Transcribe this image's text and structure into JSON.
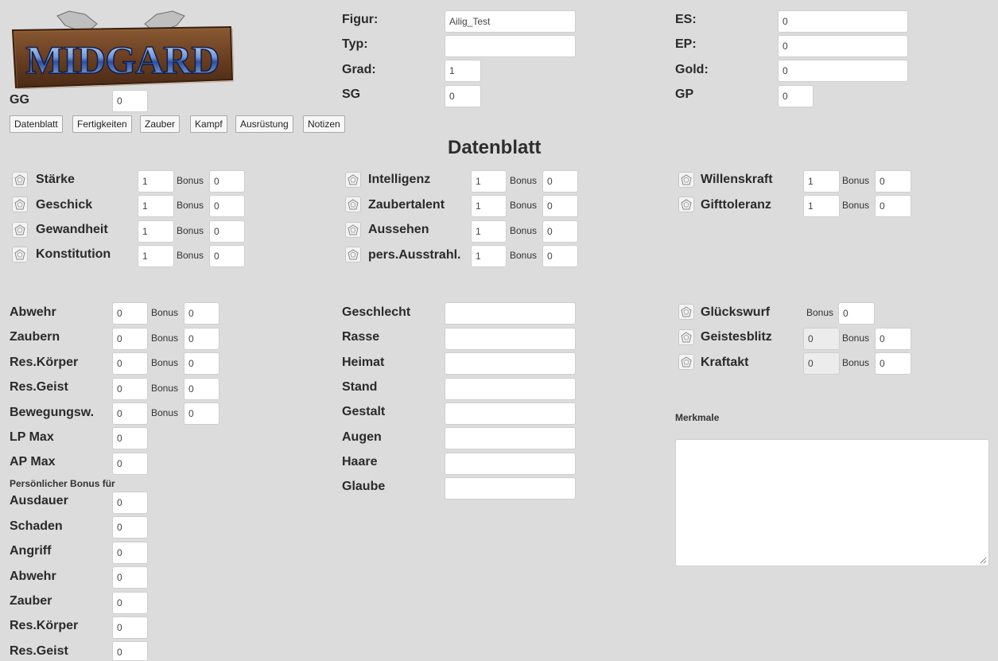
{
  "logo": {
    "text": "MIDGARD",
    "colors": {
      "wood": "#6b3f22",
      "text": "#3a5fb8",
      "highlight": "#b9d3ff"
    }
  },
  "header": {
    "gg": {
      "label": "GG",
      "value": "0"
    },
    "left_fields": [
      {
        "label": "Figur:",
        "value": "Ailig_Test"
      },
      {
        "label": "Typ:",
        "value": ""
      },
      {
        "label": "Grad:",
        "value": "1"
      },
      {
        "label": "SG",
        "value": "0"
      }
    ],
    "right_fields": [
      {
        "label": "ES:",
        "value": "0"
      },
      {
        "label": "EP:",
        "value": "0"
      },
      {
        "label": "Gold:",
        "value": "0"
      },
      {
        "label": "GP",
        "value": "0"
      }
    ]
  },
  "tabs": [
    "Datenblatt",
    "Fertigkeiten",
    "Zauber",
    "Kampf",
    "Ausrüstung",
    "Notizen"
  ],
  "page_title": "Datenblatt",
  "bonus_label": "Bonus",
  "attributes": {
    "col1": [
      {
        "label": "Stärke",
        "value": "1",
        "bonus": "0"
      },
      {
        "label": "Geschick",
        "value": "1",
        "bonus": "0"
      },
      {
        "label": "Gewandheit",
        "value": "1",
        "bonus": "0"
      },
      {
        "label": "Konstitution",
        "value": "1",
        "bonus": "0"
      }
    ],
    "col2": [
      {
        "label": "Intelligenz",
        "value": "1",
        "bonus": "0"
      },
      {
        "label": "Zaubertalent",
        "value": "1",
        "bonus": "0"
      },
      {
        "label": "Aussehen",
        "value": "1",
        "bonus": "0"
      },
      {
        "label": "pers.Ausstrahl.",
        "value": "1",
        "bonus": "0"
      }
    ],
    "col3": [
      {
        "label": "Willenskraft",
        "value": "1",
        "bonus": "0"
      },
      {
        "label": "Gifttoleranz",
        "value": "1",
        "bonus": "0"
      }
    ]
  },
  "derived": [
    {
      "label": "Abwehr",
      "value": "0",
      "bonus": "0"
    },
    {
      "label": "Zaubern",
      "value": "0",
      "bonus": "0"
    },
    {
      "label": "Res.Körper",
      "value": "0",
      "bonus": "0"
    },
    {
      "label": "Res.Geist",
      "value": "0",
      "bonus": "0"
    },
    {
      "label": "Bewegungsw.",
      "value": "0",
      "bonus": "0"
    },
    {
      "label": "LP Max",
      "value": "0"
    },
    {
      "label": "AP Max",
      "value": "0"
    }
  ],
  "personal_bonus": {
    "heading": "Persönlicher Bonus für",
    "items": [
      {
        "label": "Ausdauer",
        "value": "0"
      },
      {
        "label": "Schaden",
        "value": "0"
      },
      {
        "label": "Angriff",
        "value": "0"
      },
      {
        "label": "Abwehr",
        "value": "0"
      },
      {
        "label": "Zauber",
        "value": "0"
      },
      {
        "label": "Res.Körper",
        "value": "0"
      },
      {
        "label": "Res.Geist",
        "value": "0"
      }
    ]
  },
  "personal": [
    {
      "label": "Geschlecht",
      "value": ""
    },
    {
      "label": "Rasse",
      "value": ""
    },
    {
      "label": "Heimat",
      "value": ""
    },
    {
      "label": "Stand",
      "value": ""
    },
    {
      "label": "Gestalt",
      "value": ""
    },
    {
      "label": "Augen",
      "value": ""
    },
    {
      "label": "Haare",
      "value": ""
    },
    {
      "label": "Glaube",
      "value": ""
    }
  ],
  "special": {
    "gluecks": {
      "label": "Glückswurf",
      "bonus": "0"
    },
    "geistes": {
      "label": "Geistesblitz",
      "value": "0",
      "bonus": "0"
    },
    "kraft": {
      "label": "Kraftakt",
      "value": "0",
      "bonus": "0"
    }
  },
  "merkmale": {
    "label": "Merkmale",
    "value": ""
  }
}
